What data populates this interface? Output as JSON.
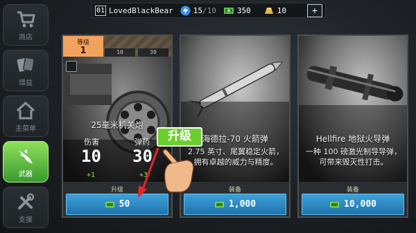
{
  "topbar": {
    "level": "01",
    "username": "LovedBlackBear",
    "energy_current": "15",
    "energy_max": "/10",
    "cash": "350",
    "gold": "10",
    "plus": "+"
  },
  "sidebar": {
    "items": [
      {
        "label": "商店",
        "icon": "cart-icon",
        "active": false
      },
      {
        "label": "增益",
        "icon": "cards-icon",
        "active": false
      },
      {
        "label": "主菜单",
        "icon": "home-icon",
        "active": false
      },
      {
        "label": "武器",
        "icon": "missile-icon",
        "active": true
      },
      {
        "label": "支援",
        "icon": "tools-icon",
        "active": false
      }
    ]
  },
  "cards": [
    {
      "level_label": "等级",
      "level_value": "1",
      "level_steps": [
        "10",
        "30"
      ],
      "name": "25毫米机关炮",
      "stats": [
        {
          "label": "伤害",
          "value": "10",
          "increase": "+1"
        },
        {
          "label": "弹药",
          "value": "30",
          "increase": "+3"
        }
      ],
      "action_label": "升级",
      "price": "50"
    },
    {
      "name": "海德拉-70 火箭弹",
      "description": "2.75 英寸、尾翼稳定火箭，拥有卓越的威力与精度。",
      "action_label": "装备",
      "price": "1,000"
    },
    {
      "name": "Hellfire 地狱火导弹",
      "description": "一种 100 磅激光制导导弹，可带来毁灭性打击。",
      "action_label": "装备",
      "price": "10,000"
    }
  ],
  "callout": {
    "text": "升级"
  },
  "colors": {
    "accent_green": "#8ee05a",
    "button_blue": "#2a88c4",
    "level_orange": "#f2a15e",
    "arrow_red": "#e8232a"
  }
}
